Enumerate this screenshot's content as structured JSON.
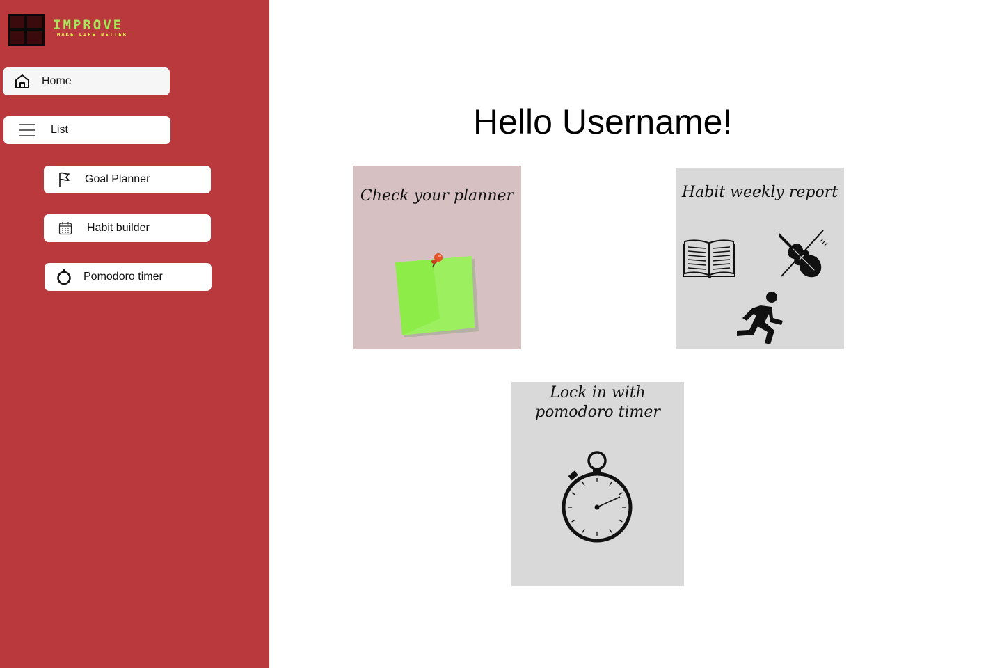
{
  "brand": {
    "name": "IMPROVE",
    "tagline": "MAKE LIFE BETTER"
  },
  "sidebar": {
    "items": [
      {
        "label": "Home",
        "icon": "home-icon"
      },
      {
        "label": "List",
        "icon": "menu-icon"
      },
      {
        "label": "Goal Planner",
        "icon": "flag-icon"
      },
      {
        "label": "Habit builder",
        "icon": "calendar-icon"
      },
      {
        "label": "Pomodoro timer",
        "icon": "timer-icon"
      }
    ]
  },
  "main": {
    "greeting": "Hello Username!",
    "cards": [
      {
        "title": "Check your planner",
        "icon": "sticky-note-icon"
      },
      {
        "title": "Habit weekly report",
        "icons": [
          "book-icon",
          "violin-icon",
          "running-person-icon"
        ]
      },
      {
        "title_line1": "Lock in with",
        "title_line2": "pomodoro timer",
        "icon": "stopwatch-icon"
      }
    ]
  },
  "colors": {
    "sidebar": "#b9393c",
    "brand": "#a9e85a",
    "card_planner": "#d6c0c1",
    "card_gray": "#d9d9d9"
  }
}
